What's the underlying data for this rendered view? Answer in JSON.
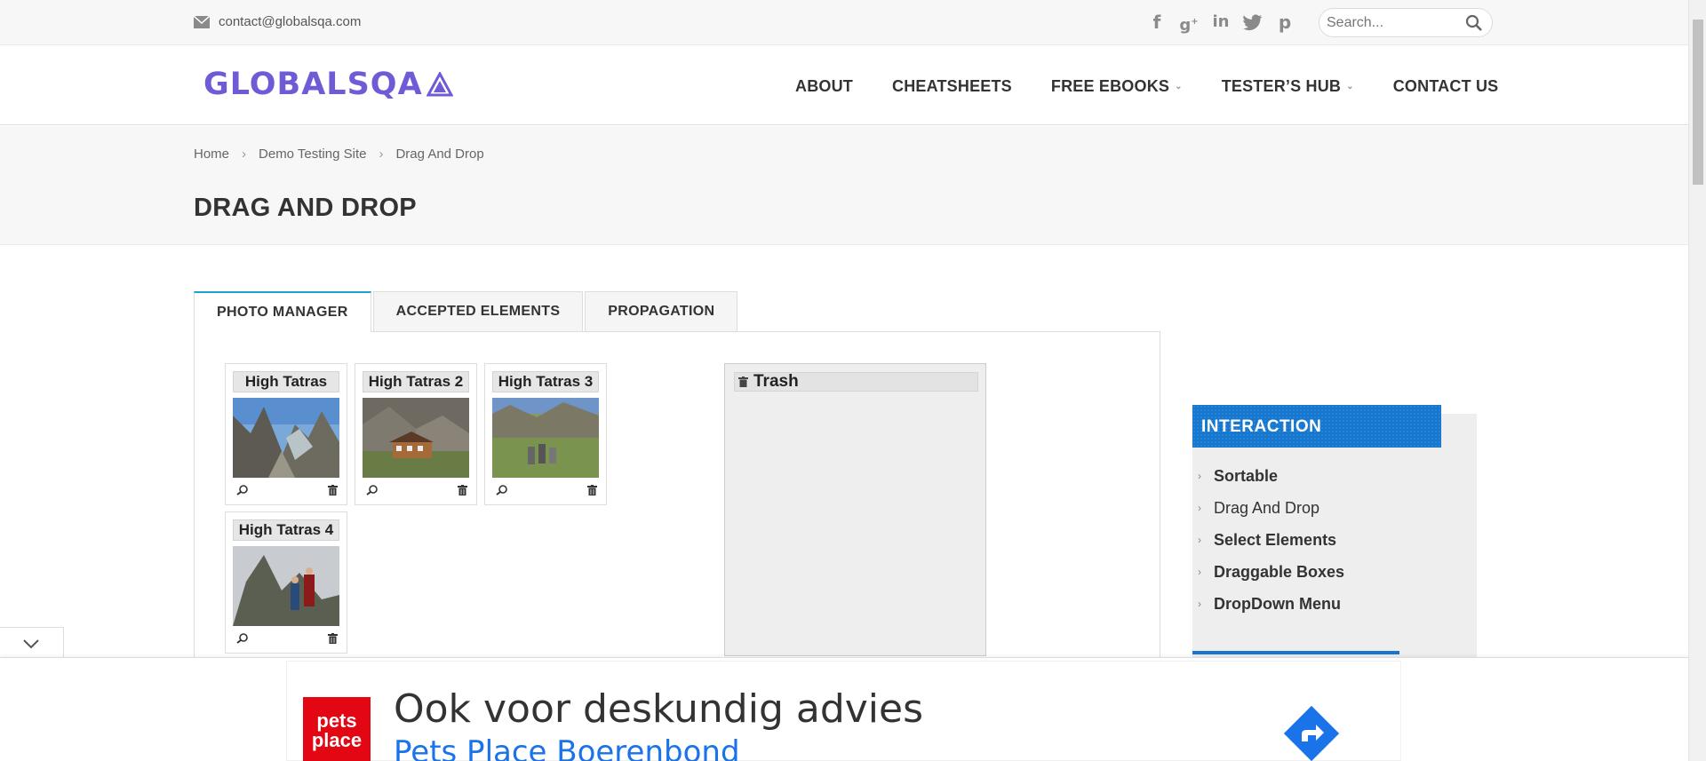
{
  "topbar": {
    "email": "contact@globalsqa.com",
    "social": [
      "facebook-icon",
      "google-plus-icon",
      "linkedin-icon",
      "twitter-icon",
      "pinterest-icon"
    ],
    "search_placeholder": "Search..."
  },
  "header": {
    "logo": "GLOBALSQA",
    "nav": [
      {
        "label": "ABOUT",
        "dropdown": false
      },
      {
        "label": "CHEATSHEETS",
        "dropdown": false
      },
      {
        "label": "FREE EBOOKS",
        "dropdown": true
      },
      {
        "label": "TESTER’S HUB",
        "dropdown": true
      },
      {
        "label": "CONTACT US",
        "dropdown": false
      }
    ]
  },
  "breadcrumb": [
    "Home",
    "Demo Testing Site",
    "Drag And Drop"
  ],
  "page_title": "DRAG AND DROP",
  "tabs": [
    "PHOTO MANAGER",
    "ACCEPTED ELEMENTS",
    "PROPAGATION"
  ],
  "active_tab": "PHOTO MANAGER",
  "gallery": [
    "High Tatras",
    "High Tatras 2",
    "High Tatras 3",
    "High Tatras 4"
  ],
  "trash": {
    "title": "Trash"
  },
  "sidebar": {
    "title": "INTERACTION",
    "items": [
      "Sortable",
      "Drag And Drop",
      "Select Elements",
      "Draggable Boxes",
      "DropDown Menu"
    ]
  },
  "ad": {
    "logo_line1": "pets",
    "logo_line2": "place",
    "headline": "Ook voor deskundig advies",
    "brand": "Pets Place Boerenbond"
  },
  "colors": {
    "accent": "#1577cf",
    "logo": "#6f5bd6",
    "tab_active": "#1ba3d3",
    "ad_red": "#e30613",
    "ad_blue": "#1a73e8"
  }
}
